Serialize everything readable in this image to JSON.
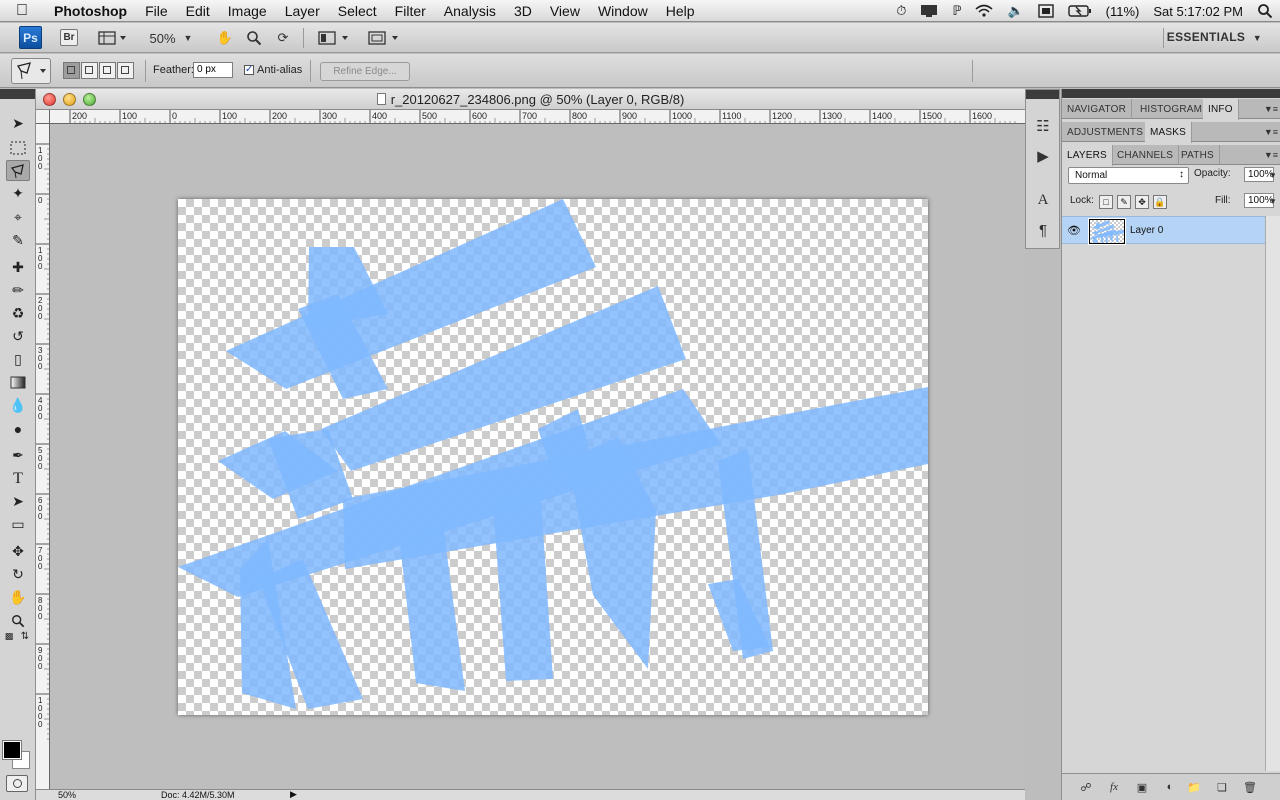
{
  "menubar": {
    "app_name": "Photoshop",
    "items": [
      "File",
      "Edit",
      "Image",
      "Layer",
      "Select",
      "Filter",
      "Analysis",
      "3D",
      "View",
      "Window",
      "Help"
    ],
    "battery": "(11%)",
    "clock": "Sat 5:17:02 PM"
  },
  "appbar": {
    "ps_logo": "Ps",
    "br_logo": "Br",
    "zoom": "50%",
    "workspace": "ESSENTIALS"
  },
  "options": {
    "feather_label": "Feather:",
    "feather_value": "0 px",
    "antialias_label": "Anti-alias",
    "antialias_checked": true,
    "refine_edge": "Refine Edge..."
  },
  "document": {
    "title": "r_20120627_234806.png @ 50% (Layer 0, RGB/8)",
    "ruler_h": [
      "200",
      "100",
      "0",
      "100",
      "200",
      "300",
      "400",
      "500",
      "600",
      "700",
      "800",
      "900",
      "1000",
      "1100",
      "1200",
      "1300",
      "1400",
      "1500",
      "1600"
    ],
    "ruler_v": [
      "1 0 0",
      "0",
      "1 0 0",
      "2 0 0",
      "3 0 0",
      "4 0 0",
      "5 0 0",
      "6 0 0",
      "7 0 0",
      "8 0 0",
      "9 0 0",
      "1 0 0 0"
    ],
    "status_zoom": "50%",
    "status_doc": "Doc: 4.42M/5.30M",
    "shape_color": "#7fb8ff"
  },
  "panels": {
    "group1_tabs": [
      "NAVIGATOR",
      "HISTOGRAM",
      "INFO"
    ],
    "group2_tabs": [
      "ADJUSTMENTS",
      "MASKS"
    ],
    "group3_tabs": [
      "LAYERS",
      "CHANNELS",
      "PATHS"
    ],
    "blend_mode": "Normal",
    "opacity_label": "Opacity:",
    "opacity_value": "100%",
    "lock_label": "Lock:",
    "fill_label": "Fill:",
    "fill_value": "100%",
    "layer_name": "Layer 0"
  }
}
